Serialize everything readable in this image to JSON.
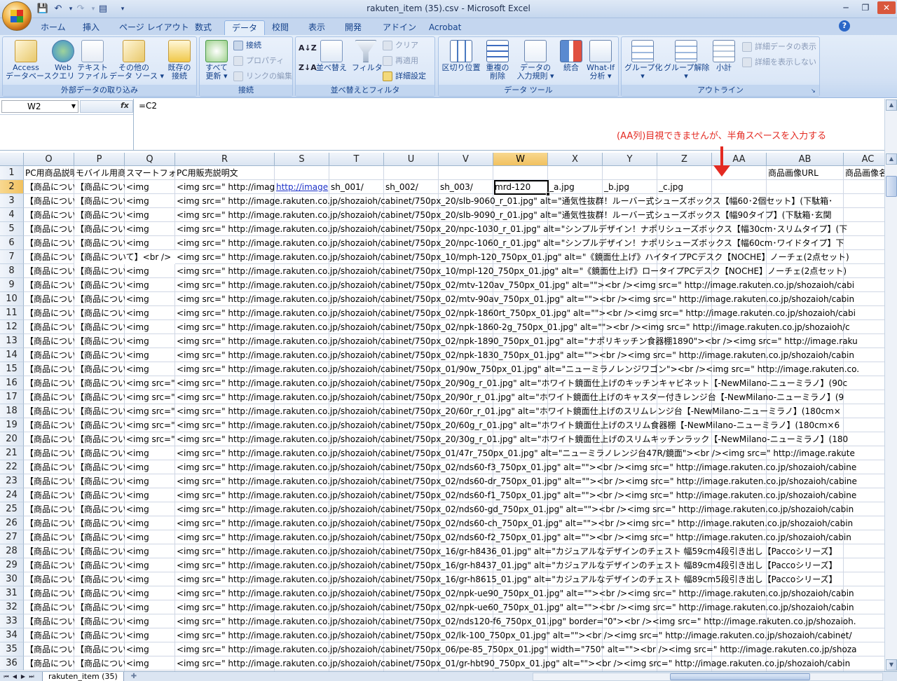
{
  "window": {
    "title": "rakuten_item (35).csv - Microsoft Excel",
    "minimize": "─",
    "restore": "❐",
    "close": "✕"
  },
  "qat": {
    "save": "💾",
    "undo": "↶",
    "redo": "↷",
    "form": "▤",
    "customize": "▾"
  },
  "tabs": [
    "ホーム",
    "挿入",
    "ページ レイアウト",
    "数式",
    "データ",
    "校閲",
    "表示",
    "開発",
    "アドイン",
    "Acrobat"
  ],
  "active_tab": "データ",
  "ribbon": {
    "groups": [
      {
        "label": "外部データの取り込み"
      },
      {
        "label": "接続"
      },
      {
        "label": "並べ替えとフィルタ"
      },
      {
        "label": "データ ツール"
      },
      {
        "label": "アウトライン"
      }
    ],
    "btn_access": [
      "Access",
      "データベース"
    ],
    "btn_web": [
      "Web",
      "クエリ"
    ],
    "btn_text": [
      "テキスト",
      "ファイル"
    ],
    "btn_other": [
      "その他の",
      "データ ソース ▾"
    ],
    "btn_existing": [
      "既存の",
      "接続"
    ],
    "btn_refresh": [
      "すべて",
      "更新 ▾"
    ],
    "btn_connections": "接続",
    "btn_properties": "プロパティ",
    "btn_edit_links": "リンクの編集",
    "btn_sort_az": "A↓Z",
    "btn_sort_za": "Z↓A",
    "btn_sort": "並べ替え",
    "btn_filter": "フィルタ",
    "btn_clear": "クリア",
    "btn_reapply": "再適用",
    "btn_advanced": "詳細設定",
    "btn_text_to_columns": [
      "区切り位置"
    ],
    "btn_remove_duplicates": [
      "重複の",
      "削除"
    ],
    "btn_data_validation": [
      "データの",
      "入力規則 ▾"
    ],
    "btn_consolidate": [
      "統合"
    ],
    "btn_whatif": [
      "What-If",
      "分析 ▾"
    ],
    "btn_group": [
      "グループ化",
      "▾"
    ],
    "btn_ungroup": [
      "グループ解除",
      "▾"
    ],
    "btn_subtotal": [
      "小計"
    ],
    "btn_show_detail": "詳細データの表示",
    "btn_hide_detail": "詳細を表示しない"
  },
  "formula_bar": {
    "name_box": "W2",
    "fx": "fx",
    "formula": "=C2"
  },
  "annotation": "(AA列)目視できませんが、半角スペースを入力する",
  "columns": [
    "O",
    "P",
    "Q",
    "R",
    "S",
    "T",
    "U",
    "V",
    "W",
    "X",
    "Y",
    "Z",
    "AA",
    "AB",
    "AC"
  ],
  "selected_column": "W",
  "rows": [
    "1",
    "2",
    "3",
    "4",
    "5",
    "6",
    "7",
    "8",
    "9",
    "10",
    "11",
    "12",
    "13",
    "14",
    "15",
    "16",
    "17",
    "18",
    "19",
    "20",
    "21",
    "22",
    "23",
    "24",
    "25",
    "26",
    "27",
    "28",
    "29",
    "30",
    "31",
    "32",
    "33",
    "34",
    "35",
    "36"
  ],
  "selected_row": "2",
  "row1": {
    "O": "PC用商品説明文",
    "P": "モバイル用商品説明文",
    "Q": "スマートフォン用商品説明文",
    "R": "PC用販売説明文",
    "AB": "商品画像URL",
    "AC": "商品画像名"
  },
  "row2": {
    "O": "【商品につい",
    "P": "【商品につい",
    "Q": "<img",
    "R": "<img src=\" http://image",
    "S": "http://image",
    "T": "sh_001/",
    "U": "sh_002/",
    "V": "sh_003/",
    "W": "mrd-120",
    "X": "_a.jpg",
    "Y": "_b.jpg",
    "Z": "_c.jpg"
  },
  "col_o_text": "【商品につい",
  "col_p_text": "【商品につい",
  "col_p_row7": "【商品について】<br />",
  "col_q_img": "<img",
  "col_q_src": "<img src=\"",
  "long_text": [
    "<img src=\" http://image.rakuten.co.jp/shozaioh/cabinet/750px_20/slb-9060_r_01.jpg\"  alt=\"通気性抜群！ルーバー式シューズボックス【幅60･2個セット】(下駄箱･",
    "<img src=\" http://image.rakuten.co.jp/shozaioh/cabinet/750px_20/slb-9090_r_01.jpg\"  alt=\"通気性抜群！ルーバー式シューズボックス【幅90タイプ】(下駄箱･玄関",
    "<img src=\" http://image.rakuten.co.jp/shozaioh/cabinet/750px_20/npc-1030_r_01.jpg\"  alt=\"シンプルデザイン！ナポリシューズボックス【幅30cm･スリムタイプ】(下",
    "<img src=\" http://image.rakuten.co.jp/shozaioh/cabinet/750px_20/npc-1060_r_01.jpg\"  alt=\"シンプルデザイン！ナポリシューズボックス【幅60cm･ワイドタイプ】下",
    "<img src=\" http://image.rakuten.co.jp/shozaioh/cabinet/750px_10/mph-120_750px_01.jpg\"  alt=\"《鏡面仕上げ》ハイタイプPCデスク【NOCHE】ノーチェ(2点セット)",
    "<img src=\" http://image.rakuten.co.jp/shozaioh/cabinet/750px_10/mpl-120_750px_01.jpg\"  alt=\"《鏡面仕上げ》ロータイプPCデスク【NOCHE】ノーチェ(2点セット)",
    "<img src=\" http://image.rakuten.co.jp/shozaioh/cabinet/750px_02/mtv-120av_750px_01.jpg\"  alt=\"\"><br /><img src=\" http://image.rakuten.co.jp/shozaioh/cabi",
    "<img src=\" http://image.rakuten.co.jp/shozaioh/cabinet/750px_02/mtv-90av_750px_01.jpg\"  alt=\"\"><br /><img src=\" http://image.rakuten.co.jp/shozaioh/cabin",
    "<img src=\" http://image.rakuten.co.jp/shozaioh/cabinet/750px_02/npk-1860rt_750px_01.jpg\"  alt=\"\"><br /><img src=\" http://image.rakuten.co.jp/shozaioh/cabi",
    "<img src=\" http://image.rakuten.co.jp/shozaioh/cabinet/750px_02/npk-1860-2g_750px_01.jpg\"  alt=\"\"><br /><img src=\" http://image.rakuten.co.jp/shozaioh/c",
    "<img src=\" http://image.rakuten.co.jp/shozaioh/cabinet/750px_02/npk-1890_750px_01.jpg\"  alt=\"ナポリキッチン食器棚1890\"><br /><img src=\" http://image.raku",
    "<img src=\" http://image.rakuten.co.jp/shozaioh/cabinet/750px_02/npk-1830_750px_01.jpg\"  alt=\"\"><br /><img src=\" http://image.rakuten.co.jp/shozaioh/cabin",
    "<img src=\" http://image.rakuten.co.jp/shozaioh/cabinet/750px_01/90w_750px_01.jpg\"  alt=\"ニューミラノレンジワゴン\"><br /><img src=\" http://image.rakuten.co.",
    "<img src=\" http://image.rakuten.co.jp/shozaioh/cabinet/750px_20/90g_r_01.jpg\"  alt=\"ホワイト鏡面仕上げのキッチンキャビネット【-NewMilano-ニューミラノ】(90c",
    "<img src=\" http://image.rakuten.co.jp/shozaioh/cabinet/750px_20/90r_r_01.jpg\"  alt=\"ホワイト鏡面仕上げのキャスター付きレンジ台【-NewMilano-ニューミラノ】(9",
    "<img src=\" http://image.rakuten.co.jp/shozaioh/cabinet/750px_20/60r_r_01.jpg\"  alt=\"ホワイト鏡面仕上げのスリムレンジ台【-NewMilano-ニューミラノ】(180cm×",
    "<img src=\" http://image.rakuten.co.jp/shozaioh/cabinet/750px_20/60g_r_01.jpg\"  alt=\"ホワイト鏡面仕上げのスリム食器棚【-NewMilano-ニューミラノ】(180cm×6",
    "<img src=\" http://image.rakuten.co.jp/shozaioh/cabinet/750px_20/30g_r_01.jpg\"  alt=\"ホワイト鏡面仕上げのスリムキッチンラック【-NewMilano-ニューミラノ】(180",
    "<img src=\" http://image.rakuten.co.jp/shozaioh/cabinet/750px_01/47r_750px_01.jpg\"  alt=\"ニューミラノレンジ台47R/鏡面\"><br /><img src=\" http://image.rakute",
    "<img src=\" http://image.rakuten.co.jp/shozaioh/cabinet/750px_02/nds60-f3_750px_01.jpg\"  alt=\"\"><br /><img src=\" http://image.rakuten.co.jp/shozaioh/cabine",
    "<img src=\" http://image.rakuten.co.jp/shozaioh/cabinet/750px_02/nds60-dr_750px_01.jpg\"  alt=\"\"><br /><img src=\" http://image.rakuten.co.jp/shozaioh/cabine",
    "<img src=\" http://image.rakuten.co.jp/shozaioh/cabinet/750px_02/nds60-f1_750px_01.jpg\"  alt=\"\"><br /><img src=\" http://image.rakuten.co.jp/shozaioh/cabine",
    "<img src=\" http://image.rakuten.co.jp/shozaioh/cabinet/750px_02/nds60-gd_750px_01.jpg\"  alt=\"\"><br /><img src=\" http://image.rakuten.co.jp/shozaioh/cabin",
    "<img src=\" http://image.rakuten.co.jp/shozaioh/cabinet/750px_02/nds60-ch_750px_01.jpg\"  alt=\"\"><br /><img src=\" http://image.rakuten.co.jp/shozaioh/cabin",
    "<img src=\" http://image.rakuten.co.jp/shozaioh/cabinet/750px_02/nds60-f2_750px_01.jpg\"  alt=\"\"><br /><img src=\" http://image.rakuten.co.jp/shozaioh/cabin",
    "<img src=\" http://image.rakuten.co.jp/shozaioh/cabinet/750px_16/gr-h8436_01.jpg\"  alt=\"カジュアルなデザインのチェスト 幅59cm4段引き出し【Paccoシリーズ】",
    "<img src=\" http://image.rakuten.co.jp/shozaioh/cabinet/750px_16/gr-h8437_01.jpg\"  alt=\"カジュアルなデザインのチェスト 幅89cm4段引き出し【Paccoシリーズ】",
    "<img src=\" http://image.rakuten.co.jp/shozaioh/cabinet/750px_16/gr-h8615_01.jpg\"  alt=\"カジュアルなデザインのチェスト 幅89cm5段引き出し【Paccoシリーズ】",
    "<img src=\" http://image.rakuten.co.jp/shozaioh/cabinet/750px_02/npk-ue90_750px_01.jpg\"  alt=\"\"><br /><img src=\" http://image.rakuten.co.jp/shozaioh/cabin",
    "<img src=\" http://image.rakuten.co.jp/shozaioh/cabinet/750px_02/npk-ue60_750px_01.jpg\"  alt=\"\"><br /><img src=\" http://image.rakuten.co.jp/shozaioh/cabin",
    "<img src=\" http://image.rakuten.co.jp/shozaioh/cabinet/750px_02/nds120-f6_750px_01.jpg\"  border=\"0\"><br /><img src=\" http://image.rakuten.co.jp/shozaioh.",
    "<img src=\" http://image.rakuten.co.jp/shozaioh/cabinet/750px_02/lk-100_750px_01.jpg\"  alt=\"\"><br /><img src=\" http://image.rakuten.co.jp/shozaioh/cabinet/",
    "<img src=\" http://image.rakuten.co.jp/shozaioh/cabinet/750px_06/pe-85_750px_01.jpg\"  width=\"750\"  alt=\"\"><br /><img src=\" http://image.rakuten.co.jp/shoza",
    "<img src=\" http://image.rakuten.co.jp/shozaioh/cabinet/750px_01/gr-hbt90_750px_01.jpg\"  alt=\"\"><br /><img src=\" http://image.rakuten.co.jp/shozaioh/cabin"
  ],
  "sheet_tab": "rakuten_item (35)",
  "sheet_nav": [
    "⏮",
    "◀",
    "▶",
    "⏭"
  ]
}
